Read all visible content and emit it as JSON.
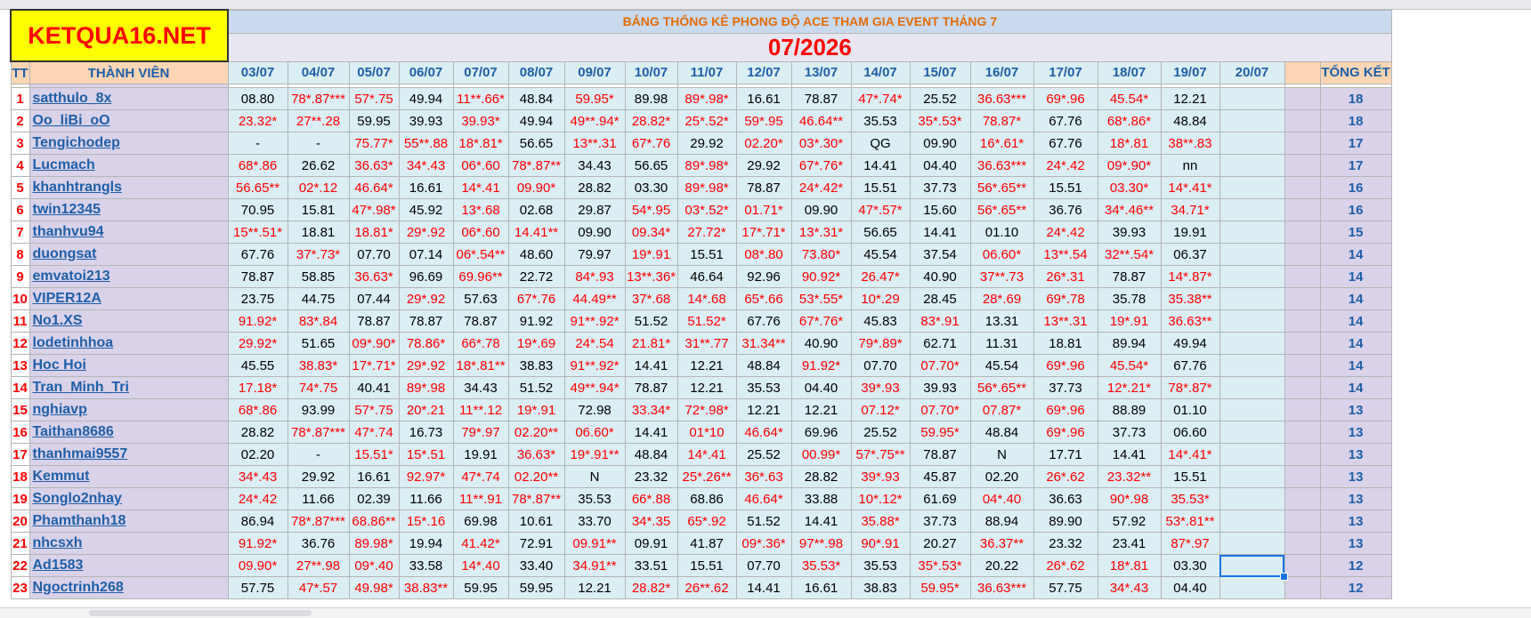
{
  "brand": "KETQUA16.NET",
  "title": "BẢNG THỐNG KÊ PHONG ĐỘ ACE THAM GIA EVENT THÁNG 7",
  "month": "07/2026",
  "headers": {
    "tt": "TT",
    "member": "THÀNH VIÊN",
    "dates": [
      "03/07",
      "04/07",
      "05/07",
      "06/07",
      "07/07",
      "08/07",
      "09/07",
      "10/07",
      "11/07",
      "12/07",
      "13/07",
      "14/07",
      "15/07",
      "16/07",
      "17/07",
      "18/07",
      "19/07",
      "20/07"
    ],
    "total": "TỔNG KẾT"
  },
  "rows": [
    {
      "tt": "1",
      "name": "satthulo_8x",
      "vals": [
        "08.80",
        "78*.87***",
        "57*.75",
        "49.94",
        "11**.66*",
        "48.84",
        "59.95*",
        "89.98",
        "89*.98*",
        "16.61",
        "78.87",
        "47*.74*",
        "25.52",
        "36.63***",
        "69*.96",
        "45.54*",
        "12.21",
        ""
      ],
      "total": "18"
    },
    {
      "tt": "2",
      "name": "Oo_liBi_oO",
      "vals": [
        "23.32*",
        "27**.28",
        "59.95",
        "39.93",
        "39.93*",
        "49.94",
        "49**.94*",
        "28.82*",
        "25*.52*",
        "59*.95",
        "46.64**",
        "35.53",
        "35*.53*",
        "78.87*",
        "67.76",
        "68*.86*",
        "48.84",
        ""
      ],
      "total": "18"
    },
    {
      "tt": "3",
      "name": "Tengichodep",
      "vals": [
        "-",
        "-",
        "75.77*",
        "55**.88",
        "18*.81*",
        "56.65",
        "13**.31",
        "67*.76",
        "29.92",
        "02.20*",
        "03*.30*",
        "QG",
        "09.90",
        "16*.61*",
        "67.76",
        "18*.81",
        "38**.83",
        ""
      ],
      "total": "17"
    },
    {
      "tt": "4",
      "name": "Lucmach",
      "vals": [
        "68*.86",
        "26.62",
        "36.63*",
        "34*.43",
        "06*.60",
        "78*.87**",
        "34.43",
        "56.65",
        "89*.98*",
        "29.92",
        "67*.76*",
        "14.41",
        "04.40",
        "36.63***",
        "24*.42",
        "09*.90*",
        "nn",
        ""
      ],
      "total": "17"
    },
    {
      "tt": "5",
      "name": "khanhtrangls",
      "vals": [
        "56.65**",
        "02*.12",
        "46.64*",
        "16.61",
        "14*.41",
        "09.90*",
        "28.82",
        "03.30",
        "89*.98*",
        "78.87",
        "24*.42*",
        "15.51",
        "37.73",
        "56*.65**",
        "15.51",
        "03.30*",
        "14*.41*",
        ""
      ],
      "total": "16"
    },
    {
      "tt": "6",
      "name": "twin12345",
      "vals": [
        "70.95",
        "15.81",
        "47*.98*",
        "45.92",
        "13*.68",
        "02.68",
        "29.87",
        "54*.95",
        "03*.52*",
        "01.71*",
        "09.90",
        "47*.57*",
        "15.60",
        "56*.65**",
        "36.76",
        "34*.46**",
        "34.71*",
        ""
      ],
      "total": "16"
    },
    {
      "tt": "7",
      "name": "thanhvu94",
      "vals": [
        "15**.51*",
        "18.81",
        "18.81*",
        "29*.92",
        "06*.60",
        "14.41**",
        "09.90",
        "09.34*",
        "27.72*",
        "17*.71*",
        "13*.31*",
        "56.65",
        "14.41",
        "01.10",
        "24*.42",
        "39.93",
        "19.91",
        ""
      ],
      "total": "15"
    },
    {
      "tt": "8",
      "name": "duongsat",
      "vals": [
        "67.76",
        "37*.73*",
        "07.70",
        "07.14",
        "06*.54**",
        "48.60",
        "79.97",
        "19*.91",
        "15.51",
        "08*.80",
        "73.80*",
        "45.54",
        "37.54",
        "06.60*",
        "13**.54",
        "32**.54*",
        "06.37",
        ""
      ],
      "total": "14"
    },
    {
      "tt": "9",
      "name": "emvatoi213",
      "vals": [
        "78.87",
        "58.85",
        "36.63*",
        "96.69",
        "69.96**",
        "22.72",
        "84*.93",
        "13**.36*",
        "46.64",
        "92.96",
        "90.92*",
        "26.47*",
        "40.90",
        "37**.73",
        "26*.31",
        "78.87",
        "14*.87*",
        ""
      ],
      "total": "14"
    },
    {
      "tt": "10",
      "name": "VIPER12A",
      "vals": [
        "23.75",
        "44.75",
        "07.44",
        "29*.92",
        "57.63",
        "67*.76",
        "44.49**",
        "37*.68",
        "14*.68",
        "65*.66",
        "53*.55*",
        "10*.29",
        "28.45",
        "28*.69",
        "69*.78",
        "35.78",
        "35.38**",
        ""
      ],
      "total": "14"
    },
    {
      "tt": "11",
      "name": "No1.XS",
      "vals": [
        "91.92*",
        "83*.84",
        "78.87",
        "78.87",
        "78.87",
        "91.92",
        "91**.92*",
        "51.52",
        "51.52*",
        "67.76",
        "67*.76*",
        "45.83",
        "83*.91",
        "13.31",
        "13**.31",
        "19*.91",
        "36.63**",
        ""
      ],
      "total": "14"
    },
    {
      "tt": "12",
      "name": "lodetinhhoa",
      "vals": [
        "29.92*",
        "51.65",
        "09*.90*",
        "78.86*",
        "66*.78",
        "19*.69",
        "24*.54",
        "21.81*",
        "31**.77",
        "31.34**",
        "40.90",
        "79*.89*",
        "62.71",
        "11.31",
        "18.81",
        "89.94",
        "49.94",
        ""
      ],
      "total": "14"
    },
    {
      "tt": "13",
      "name": "Hoc Hoi",
      "vals": [
        "45.55",
        "38.83*",
        "17*.71*",
        "29*.92",
        "18*.81**",
        "38.83",
        "91**.92*",
        "14.41",
        "12.21",
        "48.84",
        "91.92*",
        "07.70",
        "07.70*",
        "45.54",
        "69*.96",
        "45.54*",
        "67.76",
        ""
      ],
      "total": "14"
    },
    {
      "tt": "14",
      "name": "Tran_Minh_Tri",
      "vals": [
        "17.18*",
        "74*.75",
        "40.41",
        "89*.98",
        "34.43",
        "51.52",
        "49**.94*",
        "78.87",
        "12.21",
        "35.53",
        "04.40",
        "39*.93",
        "39.93",
        "56*.65**",
        "37.73",
        "12*.21*",
        "78*.87*",
        ""
      ],
      "total": "14"
    },
    {
      "tt": "15",
      "name": "nghiavp",
      "vals": [
        "68*.86",
        "93.99",
        "57*.75",
        "20*.21",
        "11**.12",
        "19*.91",
        "72.98",
        "33.34*",
        "72*.98*",
        "12.21",
        "12.21",
        "07.12*",
        "07.70*",
        "07.87*",
        "69*.96",
        "88.89",
        "01.10",
        ""
      ],
      "total": "13"
    },
    {
      "tt": "16",
      "name": "Taithan8686",
      "vals": [
        "28.82",
        "78*.87***",
        "47*.74",
        "16.73",
        "79*.97",
        "02.20**",
        "06.60*",
        "14.41",
        "01*10",
        "46.64*",
        "69.96",
        "25.52",
        "59.95*",
        "48.84",
        "69*.96",
        "37.73",
        "06.60",
        ""
      ],
      "total": "13"
    },
    {
      "tt": "17",
      "name": "thanhmai9557",
      "vals": [
        "02.20",
        "-",
        "15.51*",
        "15*.51",
        "19.91",
        "36.63*",
        "19*.91**",
        "48.84",
        "14*.41",
        "25.52",
        "00.99*",
        "57*.75**",
        "78.87",
        "N",
        "17.71",
        "14.41",
        "14*.41*",
        ""
      ],
      "total": "13"
    },
    {
      "tt": "18",
      "name": "Kemmut",
      "vals": [
        "34*.43",
        "29.92",
        "16.61",
        "92.97*",
        "47*.74",
        "02.20**",
        "N",
        "23.32",
        "25*.26**",
        "36*.63",
        "28.82",
        "39*.93",
        "45.87",
        "02.20",
        "26*.62",
        "23.32**",
        "15.51",
        ""
      ],
      "total": "13"
    },
    {
      "tt": "19",
      "name": "Songlo2nhay",
      "vals": [
        "24*.42",
        "11.66",
        "02.39",
        "11.66",
        "11**.91",
        "78*.87**",
        "35.53",
        "66*.88",
        "68.86",
        "46.64*",
        "33.88",
        "10*.12*",
        "61.69",
        "04*.40",
        "36.63",
        "90*.98",
        "35.53*",
        ""
      ],
      "total": "13"
    },
    {
      "tt": "20",
      "name": "Phamthanh18",
      "vals": [
        "86.94",
        "78*.87***",
        "68.86**",
        "15*.16",
        "69.98",
        "10.61",
        "33.70",
        "34*.35",
        "65*.92",
        "51.52",
        "14.41",
        "35.88*",
        "37.73",
        "88.94",
        "89.90",
        "57.92",
        "53*.81**",
        ""
      ],
      "total": "13"
    },
    {
      "tt": "21",
      "name": "nhcsxh",
      "vals": [
        "91.92*",
        "36.76",
        "89.98*",
        "19.94",
        "41.42*",
        "72.91",
        "09.91**",
        "09.91",
        "41.87",
        "09*.36*",
        "97**.98",
        "90*.91",
        "20.27",
        "36.37**",
        "23.32",
        "23.41",
        "87*.97",
        ""
      ],
      "total": "13"
    },
    {
      "tt": "22",
      "name": "Ad1583",
      "vals": [
        "09.90*",
        "27**.98",
        "09*.40",
        "33.58",
        "14*.40",
        "33.40",
        "34.91**",
        "33.51",
        "15.51",
        "07.70",
        "35.53*",
        "35.53",
        "35*.53*",
        "20.22",
        "26*.62",
        "18*.81",
        "03.30",
        ""
      ],
      "total": "12"
    },
    {
      "tt": "23",
      "name": "Ngoctrinh268",
      "vals": [
        "57.75",
        "47*.57",
        "49.98*",
        "38.83**",
        "59.95",
        "59.95",
        "12.21",
        "28.82*",
        "26**.62",
        "14.41",
        "16.61",
        "38.83",
        "59.95*",
        "36.63***",
        "57.75",
        "34*.43",
        "04.40",
        ""
      ],
      "total": "12"
    }
  ]
}
